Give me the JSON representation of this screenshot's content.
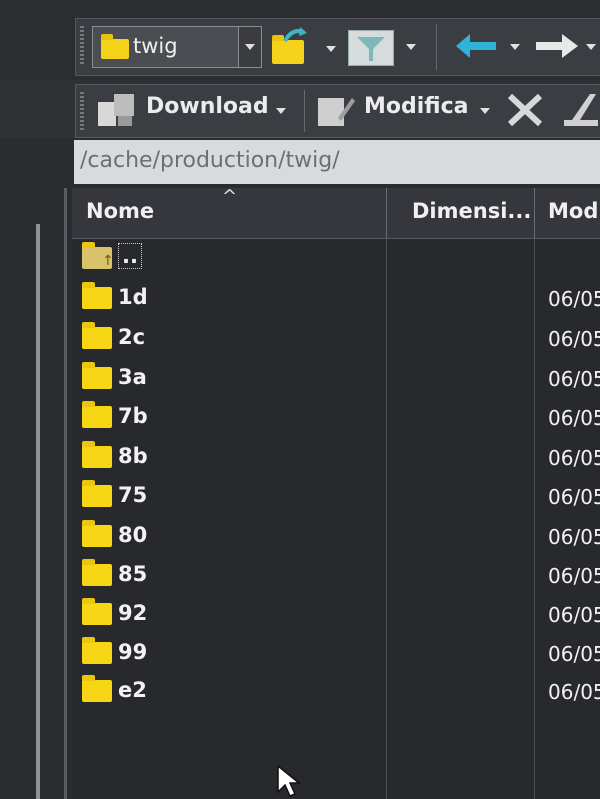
{
  "toolbar1": {
    "folder_combo_value": "twig",
    "icons": [
      "folder-open-icon",
      "filter-icon",
      "back-arrow-icon",
      "forward-arrow-icon"
    ]
  },
  "toolbar2": {
    "download_label": "Download",
    "edit_label": "Modifica",
    "icons": [
      "download-icon",
      "edit-icon",
      "delete-icon"
    ]
  },
  "path": {
    "value": "/cache/production/twig/"
  },
  "columns": [
    {
      "label": "Nome"
    },
    {
      "label": "Dimensi..."
    },
    {
      "label": "Mod"
    }
  ],
  "files": [
    {
      "name": "..",
      "date": ""
    },
    {
      "name": "1d",
      "date": "06/05"
    },
    {
      "name": "2c",
      "date": "06/05"
    },
    {
      "name": "3a",
      "date": "06/05"
    },
    {
      "name": "7b",
      "date": "06/05"
    },
    {
      "name": "8b",
      "date": "06/05"
    },
    {
      "name": "75",
      "date": "06/05"
    },
    {
      "name": "80",
      "date": "06/05"
    },
    {
      "name": "85",
      "date": "06/05"
    },
    {
      "name": "92",
      "date": "06/05"
    },
    {
      "name": "99",
      "date": "06/05"
    },
    {
      "name": "e2",
      "date": "06/05"
    }
  ],
  "colors": {
    "background": "#25272b",
    "folder": "#f7d615",
    "text": "#f2f2f2"
  }
}
